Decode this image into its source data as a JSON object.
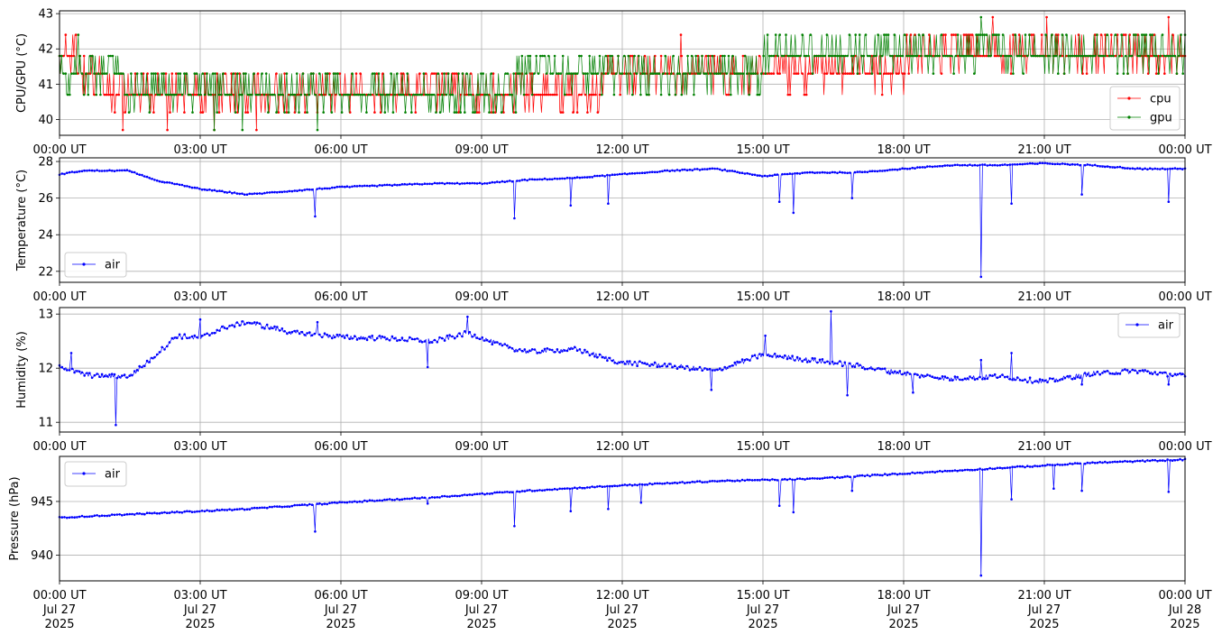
{
  "x_tick_labels": [
    "00:00 UT",
    "03:00 UT",
    "06:00 UT",
    "09:00 UT",
    "12:00 UT",
    "15:00 UT",
    "18:00 UT",
    "21:00 UT",
    "00:00 UT"
  ],
  "x_tick_dates": [
    "Jul 27",
    "Jul 27",
    "Jul 27",
    "Jul 27",
    "Jul 27",
    "Jul 27",
    "Jul 27",
    "Jul 27",
    "Jul 28"
  ],
  "x_tick_year": "2025",
  "x_range_hours": [
    0,
    24
  ],
  "chart_data": [
    {
      "type": "line",
      "ylabel": "CPU/GPU (°C)",
      "ylim": [
        39.55,
        43.08
      ],
      "yticks": [
        40,
        41,
        42,
        43
      ],
      "grid": true,
      "legend_position": "lower-right",
      "series": [
        {
          "name": "cpu",
          "color": "#ff0000",
          "levels": [
            [
              0,
              41.8
            ],
            [
              0.7,
              41.3
            ],
            [
              1.2,
              40.7
            ],
            [
              1.8,
              40.7
            ],
            [
              3,
              40.7
            ],
            [
              5,
              40.7
            ],
            [
              7,
              40.7
            ],
            [
              9,
              40.7
            ],
            [
              11,
              40.7
            ],
            [
              12.2,
              41.3
            ],
            [
              14,
              41.3
            ],
            [
              16,
              41.3
            ],
            [
              17.5,
              41.3
            ],
            [
              18.5,
              41.8
            ],
            [
              20,
              41.8
            ],
            [
              22,
              41.8
            ],
            [
              24,
              41.8
            ]
          ],
          "extremes": [
            [
              1.35,
              39.7
            ],
            [
              2.3,
              39.7
            ],
            [
              3.3,
              39.7
            ],
            [
              4.2,
              39.7
            ],
            [
              13.25,
              42.4
            ],
            [
              19.9,
              42.9
            ],
            [
              21.05,
              42.9
            ],
            [
              23.65,
              42.9
            ]
          ]
        },
        {
          "name": "gpu",
          "color": "#008000",
          "levels": [
            [
              0,
              41.3
            ],
            [
              1.2,
              41.3
            ],
            [
              1.5,
              40.7
            ],
            [
              3,
              40.7
            ],
            [
              5,
              40.7
            ],
            [
              7,
              40.7
            ],
            [
              9,
              40.7
            ],
            [
              10.5,
              41.3
            ],
            [
              12,
              41.3
            ],
            [
              14,
              41.3
            ],
            [
              16,
              41.8
            ],
            [
              18,
              41.8
            ],
            [
              19,
              42.0
            ],
            [
              20,
              41.8
            ],
            [
              24,
              41.8
            ]
          ],
          "extremes": [
            [
              0.4,
              42.4
            ],
            [
              3.3,
              39.7
            ],
            [
              3.9,
              39.7
            ],
            [
              5.5,
              39.7
            ],
            [
              19.65,
              42.9
            ],
            [
              19.9,
              42.4
            ]
          ]
        }
      ]
    },
    {
      "type": "line",
      "ylabel": "Temperature (°C)",
      "ylim": [
        21.4,
        28.2
      ],
      "yticks": [
        22,
        24,
        26,
        28
      ],
      "grid": true,
      "legend_position": "lower-left",
      "series": [
        {
          "name": "air",
          "color": "#0000ff",
          "baseline": [
            [
              0,
              27.3
            ],
            [
              0.5,
              27.5
            ],
            [
              1.5,
              27.5
            ],
            [
              2,
              27.0
            ],
            [
              3,
              26.5
            ],
            [
              4,
              26.2
            ],
            [
              5,
              26.4
            ],
            [
              6,
              26.6
            ],
            [
              7,
              26.7
            ],
            [
              8,
              26.8
            ],
            [
              9,
              26.8
            ],
            [
              10,
              27.0
            ],
            [
              11,
              27.1
            ],
            [
              12,
              27.3
            ],
            [
              13,
              27.5
            ],
            [
              14,
              27.6
            ],
            [
              15,
              27.2
            ],
            [
              16,
              27.4
            ],
            [
              17,
              27.4
            ],
            [
              18,
              27.6
            ],
            [
              19,
              27.8
            ],
            [
              20,
              27.8
            ],
            [
              21,
              27.9
            ],
            [
              22,
              27.8
            ],
            [
              23,
              27.6
            ],
            [
              24,
              27.6
            ]
          ],
          "dips": [
            [
              5.45,
              25.0
            ],
            [
              9.7,
              24.9
            ],
            [
              10.9,
              25.6
            ],
            [
              11.7,
              25.7
            ],
            [
              15.35,
              25.8
            ],
            [
              15.65,
              25.2
            ],
            [
              16.9,
              26.0
            ],
            [
              19.65,
              21.7
            ],
            [
              20.3,
              25.7
            ],
            [
              21.8,
              26.2
            ],
            [
              23.65,
              25.8
            ]
          ]
        }
      ]
    },
    {
      "type": "line",
      "ylabel": "Humidity (%)",
      "ylim": [
        10.82,
        13.12
      ],
      "yticks": [
        11,
        12,
        13
      ],
      "grid": true,
      "legend_position": "top-right",
      "series": [
        {
          "name": "air",
          "color": "#0000ff",
          "baseline": [
            [
              0,
              12.05
            ],
            [
              0.3,
              11.95
            ],
            [
              0.6,
              11.87
            ],
            [
              1,
              11.85
            ],
            [
              1.5,
              11.85
            ],
            [
              2,
              12.2
            ],
            [
              2.5,
              12.6
            ],
            [
              3,
              12.55
            ],
            [
              3.5,
              12.75
            ],
            [
              4,
              12.85
            ],
            [
              5,
              12.65
            ],
            [
              6,
              12.58
            ],
            [
              7,
              12.55
            ],
            [
              8,
              12.5
            ],
            [
              8.7,
              12.65
            ],
            [
              9,
              12.55
            ],
            [
              9.5,
              12.4
            ],
            [
              10,
              12.3
            ],
            [
              11,
              12.35
            ],
            [
              12,
              12.1
            ],
            [
              13,
              12.05
            ],
            [
              14,
              11.95
            ],
            [
              15,
              12.25
            ],
            [
              16,
              12.15
            ],
            [
              17,
              12.05
            ],
            [
              18,
              11.9
            ],
            [
              19,
              11.8
            ],
            [
              20,
              11.85
            ],
            [
              21,
              11.75
            ],
            [
              22,
              11.9
            ],
            [
              23,
              11.95
            ],
            [
              24,
              11.85
            ]
          ],
          "spikes": [
            [
              0.25,
              12.28
            ],
            [
              1.2,
              10.95
            ],
            [
              3.0,
              12.9
            ],
            [
              5.5,
              12.85
            ],
            [
              7.85,
              12.02
            ],
            [
              8.7,
              12.95
            ],
            [
              13.9,
              11.6
            ],
            [
              15.05,
              12.6
            ],
            [
              16.45,
              13.05
            ],
            [
              16.8,
              11.5
            ],
            [
              18.2,
              11.55
            ],
            [
              19.65,
              12.15
            ],
            [
              20.3,
              12.28
            ],
            [
              21.8,
              11.7
            ],
            [
              23.65,
              11.7
            ]
          ]
        }
      ]
    },
    {
      "type": "line",
      "ylabel": "Pressure (hPa)",
      "ylim": [
        937.6,
        949.2
      ],
      "yticks": [
        940,
        945
      ],
      "grid": true,
      "legend_position": "top-left",
      "series": [
        {
          "name": "air",
          "color": "#0000ff",
          "baseline": [
            [
              0,
              943.5
            ],
            [
              2,
              943.9
            ],
            [
              4,
              944.3
            ],
            [
              6,
              944.9
            ],
            [
              8,
              945.4
            ],
            [
              10,
              946.0
            ],
            [
              12,
              946.5
            ],
            [
              14,
              946.9
            ],
            [
              16,
              947.1
            ],
            [
              18,
              947.6
            ],
            [
              20,
              948.1
            ],
            [
              22,
              948.6
            ],
            [
              24,
              948.9
            ]
          ],
          "dips": [
            [
              5.45,
              942.2
            ],
            [
              7.85,
              944.8
            ],
            [
              9.7,
              942.7
            ],
            [
              10.9,
              944.1
            ],
            [
              11.7,
              944.3
            ],
            [
              12.4,
              944.9
            ],
            [
              15.35,
              944.6
            ],
            [
              15.65,
              944.0
            ],
            [
              16.9,
              946.0
            ],
            [
              19.65,
              938.1
            ],
            [
              20.3,
              945.2
            ],
            [
              21.2,
              946.2
            ],
            [
              21.8,
              946.0
            ],
            [
              23.65,
              945.9
            ]
          ]
        }
      ]
    }
  ]
}
